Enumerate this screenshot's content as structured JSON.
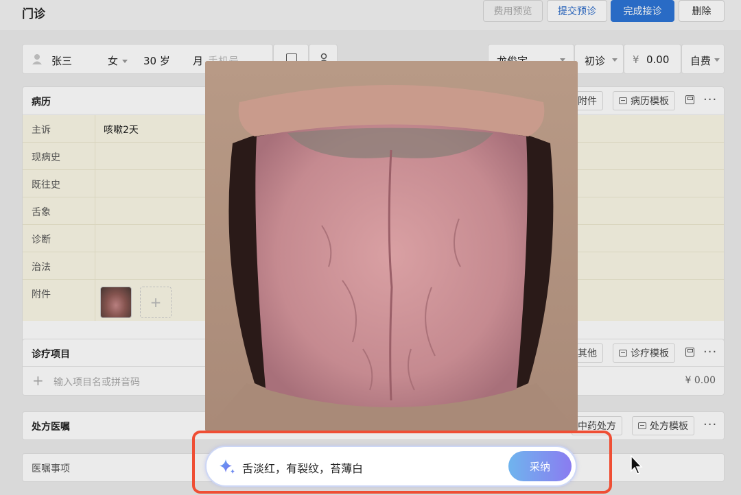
{
  "header": {
    "title": "门诊",
    "buttons": {
      "fee_preview": "费用预览",
      "submit_prediag": "提交预诊",
      "finish": "完成接诊",
      "delete": "删除"
    }
  },
  "patient": {
    "name": "张三",
    "gender": "女",
    "age": "30 岁",
    "month_label": "月",
    "phone_placeholder": "手机号",
    "doctor": "龙俊宇",
    "visit_type": "初诊",
    "currency": "¥",
    "fee": "0.00",
    "pay_type": "自费"
  },
  "record": {
    "title": "病历",
    "attach_btn": "附件",
    "template_btn": "病历模板",
    "rows": [
      {
        "label": "主诉",
        "value": "咳嗽2天"
      },
      {
        "label": "现病史",
        "value": ""
      },
      {
        "label": "既往史",
        "value": ""
      },
      {
        "label": "舌象",
        "value": ""
      },
      {
        "label": "诊断",
        "value": ""
      },
      {
        "label": "治法",
        "value": ""
      },
      {
        "label": "附件",
        "value": ""
      }
    ]
  },
  "treatment": {
    "title": "诊疗项目",
    "other_btn": "其他",
    "template_btn": "诊疗模板",
    "input_placeholder": "输入项目名或拼音码",
    "total": "¥ 0.00"
  },
  "prescription": {
    "title": "处方医嘱",
    "tcm_btn": "中药处方",
    "template_btn": "处方模板"
  },
  "advice": {
    "label": "医嘱事项"
  },
  "ai_suggestion": {
    "text": "舌淡红，有裂纹，苔薄白",
    "accept_label": "采纳"
  },
  "colors": {
    "primary": "#2d75d6",
    "highlight": "#ef4e34",
    "record_bg": "#fbf8e6"
  }
}
